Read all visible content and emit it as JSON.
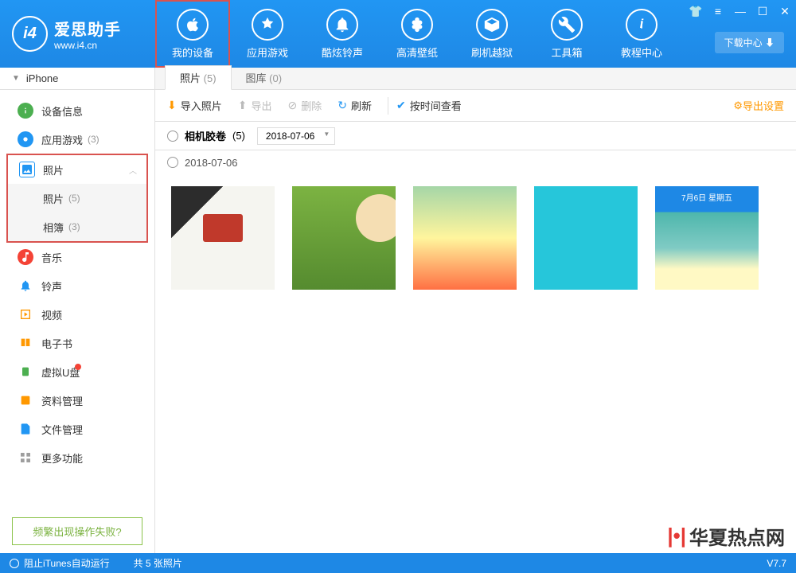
{
  "logo": {
    "icon_text": "i4",
    "title": "爱思助手",
    "url": "www.i4.cn"
  },
  "top_nav": [
    {
      "label": "我的设备",
      "highlighted": true
    },
    {
      "label": "应用游戏"
    },
    {
      "label": "酷炫铃声"
    },
    {
      "label": "高清壁纸"
    },
    {
      "label": "刷机越狱"
    },
    {
      "label": "工具箱"
    },
    {
      "label": "教程中心"
    }
  ],
  "download_center": "下载中心",
  "device_header": "iPhone",
  "sidebar": {
    "items": [
      {
        "icon": "info",
        "label": "设备信息",
        "color": "#4caf50"
      },
      {
        "icon": "apps",
        "label": "应用游戏",
        "count": "(3)",
        "color": "#2196f3"
      }
    ],
    "photos_group": {
      "label": "照片",
      "sub": [
        {
          "label": "照片",
          "count": "(5)"
        },
        {
          "label": "相簿",
          "count": "(3)"
        }
      ]
    },
    "rest": [
      {
        "icon": "music",
        "label": "音乐",
        "color": "#f44336"
      },
      {
        "icon": "bell",
        "label": "铃声",
        "color": "#2196f3"
      },
      {
        "icon": "video",
        "label": "视频",
        "color": "#ff9800"
      },
      {
        "icon": "book",
        "label": "电子书",
        "color": "#ff9800"
      },
      {
        "icon": "usb",
        "label": "虚拟U盘",
        "color": "#4caf50",
        "dot": true
      },
      {
        "icon": "data",
        "label": "资料管理",
        "color": "#ff9800"
      },
      {
        "icon": "file",
        "label": "文件管理",
        "color": "#2196f3"
      },
      {
        "icon": "more",
        "label": "更多功能",
        "color": "#9e9e9e"
      }
    ],
    "help": "频繁出现操作失败?"
  },
  "tabs": [
    {
      "label": "照片",
      "count": "(5)",
      "active": true
    },
    {
      "label": "图库",
      "count": "(0)"
    }
  ],
  "toolbar": {
    "import": "导入照片",
    "export": "导出",
    "delete": "删除",
    "refresh": "刷新",
    "by_time": "按时间查看",
    "export_settings": "导出设置"
  },
  "filter": {
    "album": "相机胶卷",
    "album_count": "(5)",
    "date": "2018-07-06"
  },
  "date_group": "2018-07-06",
  "footer": {
    "itunes": "阻止iTunes自动运行",
    "count": "共 5 张照片",
    "version": "V7.7"
  },
  "watermark": "华夏热点网"
}
